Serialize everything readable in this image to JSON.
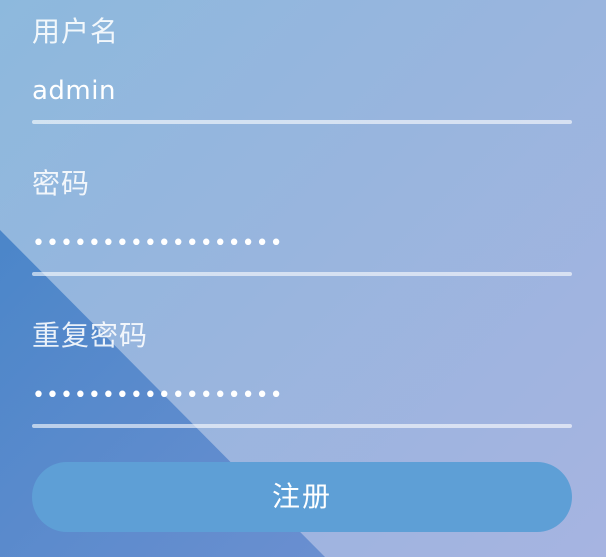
{
  "form": {
    "username": {
      "label": "用户名",
      "value": "admin"
    },
    "password": {
      "label": "密码",
      "value": "••••••••••••••••••"
    },
    "confirm_password": {
      "label": "重复密码",
      "value": "••••••••••••••••••"
    },
    "submit_label": "注册"
  },
  "colors": {
    "background_light": "#98b5de",
    "background_dark_triangle": "#4f86c9",
    "button": "#5e9fd6",
    "text": "#ffffff"
  }
}
